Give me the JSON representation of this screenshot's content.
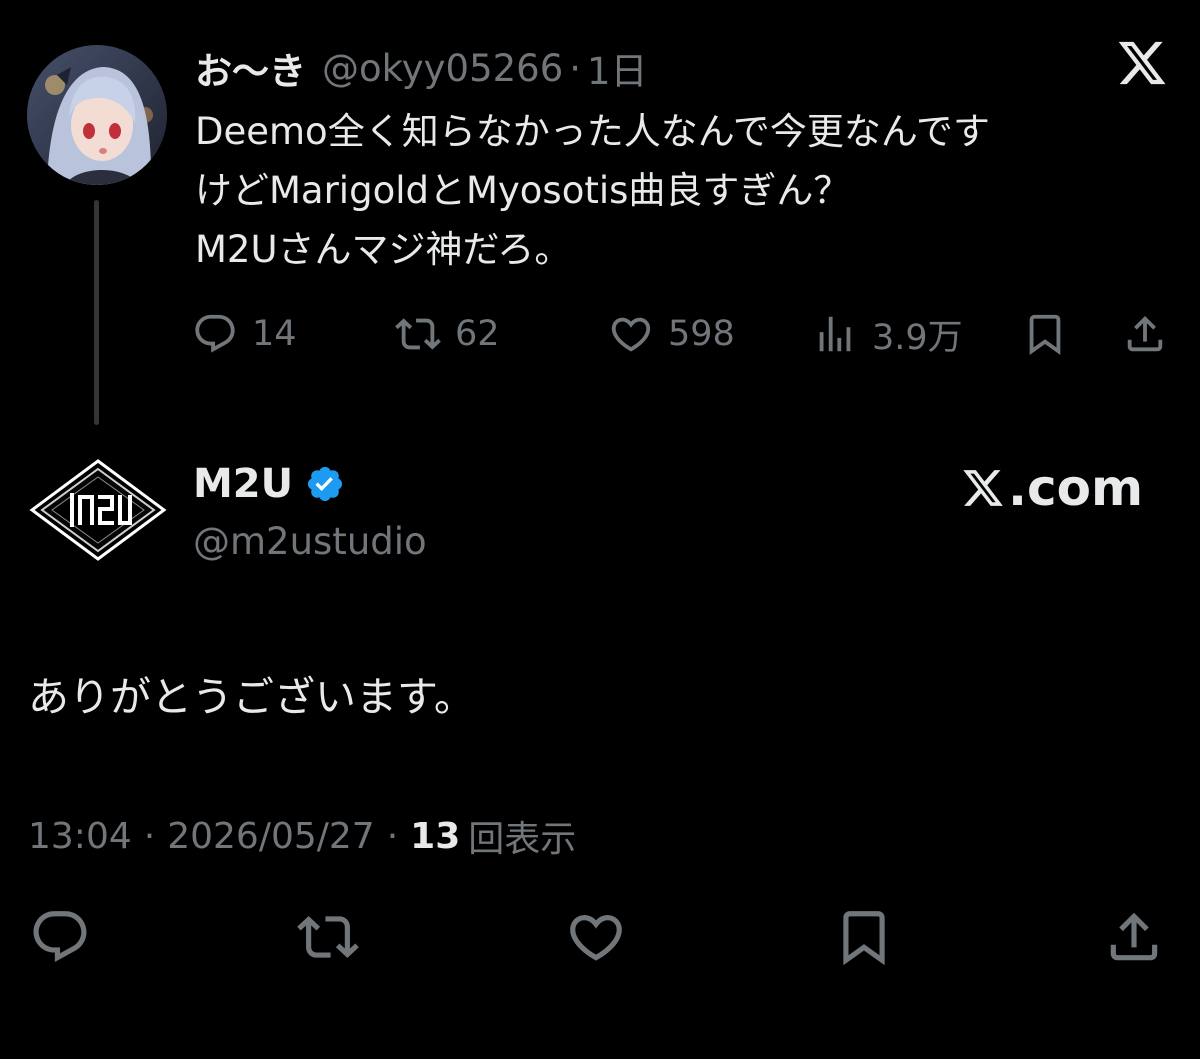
{
  "parent_tweet": {
    "display_name": "お〜き",
    "handle": "@okyy05266",
    "separator": "·",
    "time": "1日",
    "text_lines": [
      "Deemo全く知らなかった人なんで今更なんです",
      "けどMarigoldとMyosotis曲良すぎん？",
      "M2Uさんマジ神だろ。"
    ],
    "actions": {
      "replies": "14",
      "retweets": "62",
      "likes": "598",
      "views": "3.9万"
    },
    "icons": [
      "x-logo-icon",
      "reply-icon",
      "retweet-icon",
      "like-icon",
      "views-icon",
      "bookmark-icon",
      "share-icon"
    ]
  },
  "reply_tweet": {
    "display_name": "M2U",
    "handle": "@m2ustudio",
    "watermark": ".com",
    "text": "ありがとうございます。",
    "timestamp": "13:04",
    "separator": "·",
    "date": "2026/05/27",
    "views_count": "13",
    "views_label": "回表示",
    "icons": [
      "verified-badge-icon",
      "reply-icon",
      "retweet-icon",
      "like-icon",
      "bookmark-icon",
      "share-icon"
    ]
  },
  "colors": {
    "background": "#000000",
    "text_primary": "#e7e9ea",
    "text_secondary": "#71767b",
    "verified_blue": "#1d9bf0",
    "thread_line": "#333639"
  }
}
